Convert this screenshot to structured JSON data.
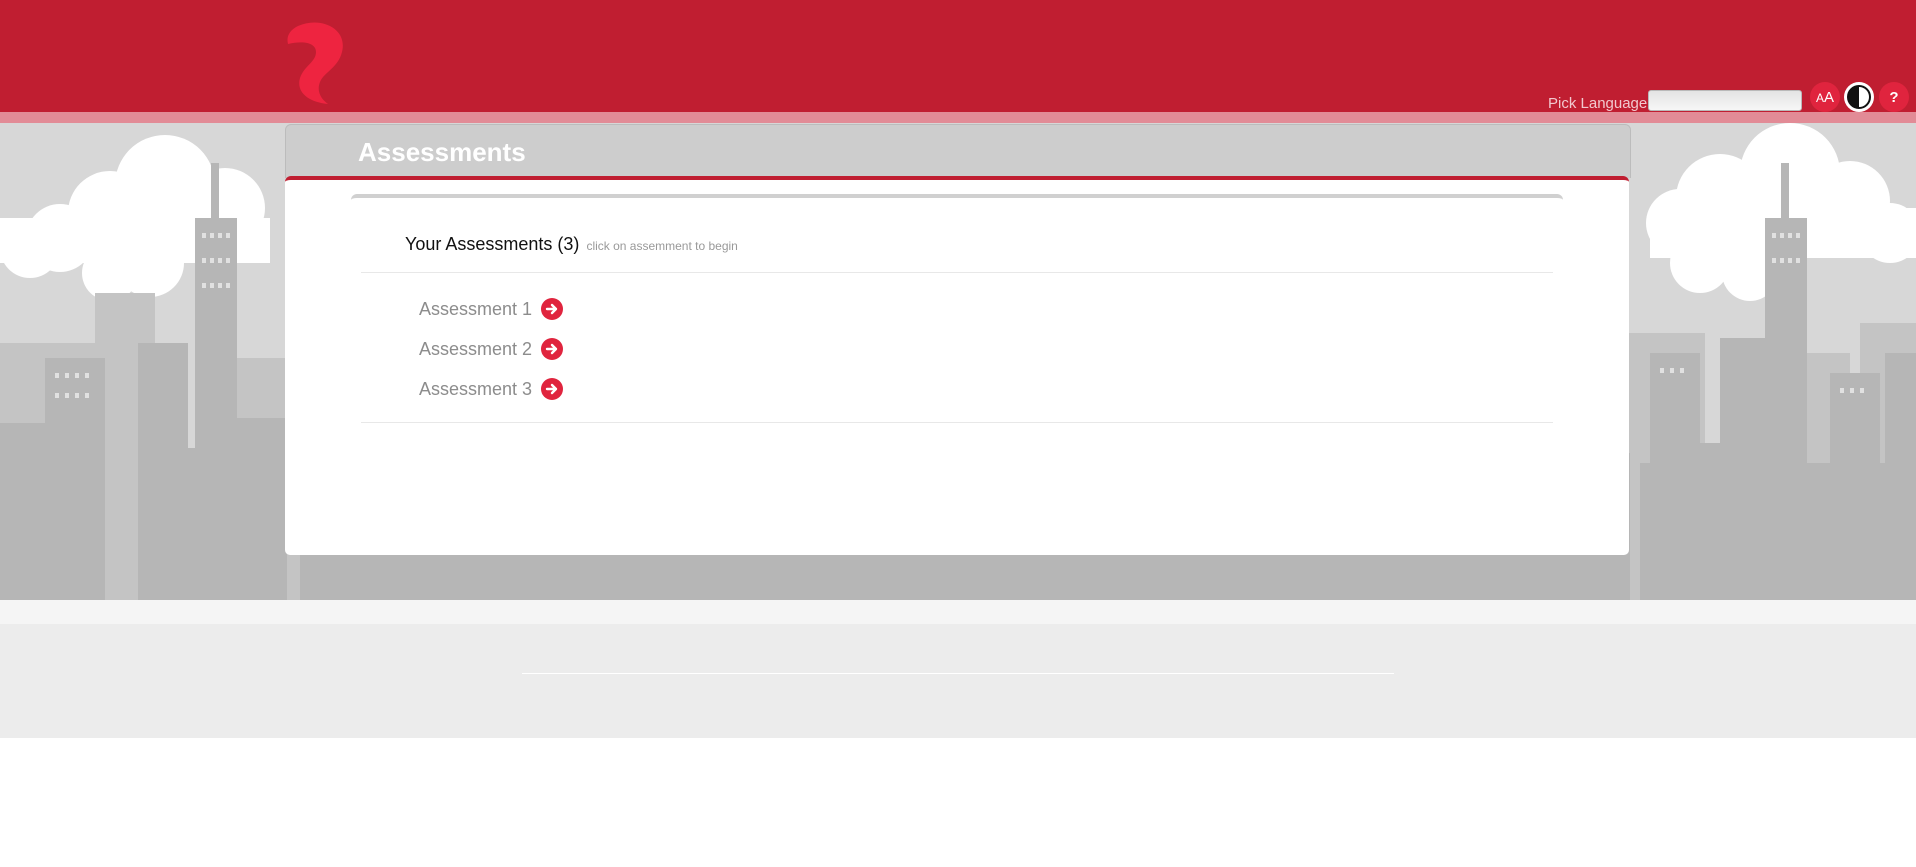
{
  "header": {
    "language_label": "Pick Language",
    "language_value": "",
    "icons": [
      "logo-icon",
      "font-size-icon",
      "contrast-icon",
      "help-icon"
    ],
    "font_size_glyph_small": "A",
    "font_size_glyph_large": "A",
    "help_glyph": "?"
  },
  "panel": {
    "title": "Assessments",
    "list_heading": "Your Assessments (3)",
    "list_hint": "click on assemment to begin",
    "items": [
      {
        "label": "Assessment 1"
      },
      {
        "label": "Assessment 2"
      },
      {
        "label": "Assessment 3"
      }
    ]
  },
  "colors": {
    "brand": "#c01e31",
    "accent": "#e0243e",
    "panel_header": "#cdcdcd",
    "skyline": "#b6b6b6"
  }
}
